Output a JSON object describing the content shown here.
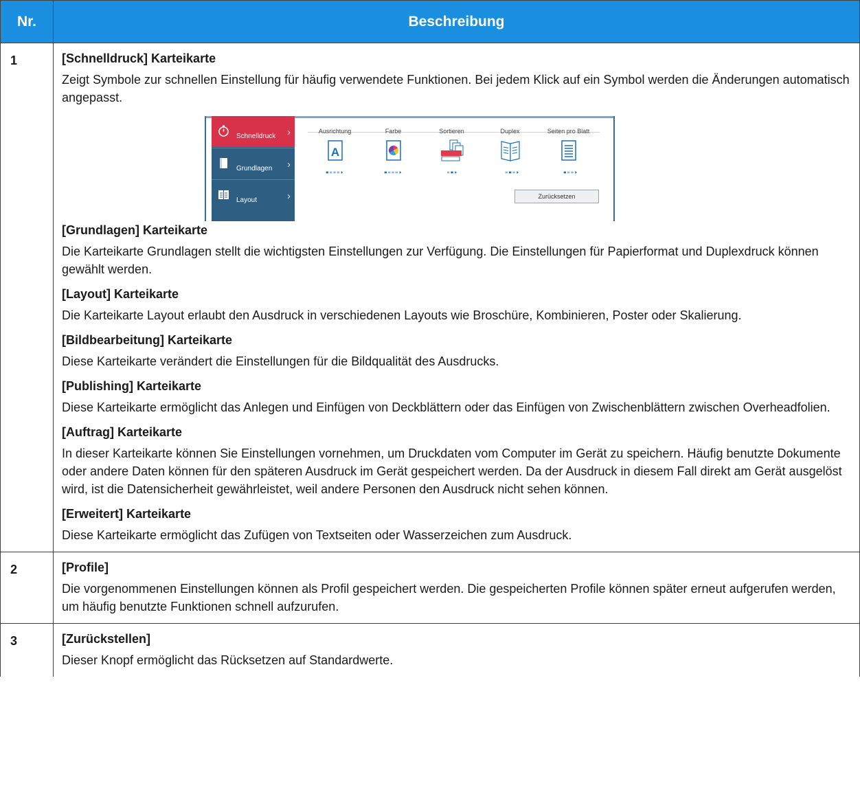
{
  "table": {
    "headers": [
      "Nr.",
      "Beschreibung"
    ],
    "rows": [
      {
        "nr": "1",
        "sections": [
          {
            "title": "[Schnelldruck] Karteikarte",
            "text": "Zeigt Symbole zur schnellen Einstellung für häufig verwendete Funktionen. Bei jedem Klick auf ein Symbol werden die Änderungen automatisch angepasst."
          },
          {
            "title": "[Grundlagen] Karteikarte",
            "text": "Die Karteikarte Grundlagen stellt die wichtigsten Einstellungen zur Verfügung. Die Einstellungen für Papierformat und Duplexdruck können gewählt werden."
          },
          {
            "title": "[Layout] Karteikarte",
            "text": "Die Karteikarte Layout erlaubt den Ausdruck in verschiedenen Layouts wie Broschüre, Kombinieren, Poster oder Skalierung."
          },
          {
            "title": "[Bildbearbeitung] Karteikarte",
            "text": "Diese Karteikarte verändert die Einstellungen für die Bildqualität des Ausdrucks."
          },
          {
            "title": "[Publishing] Karteikarte",
            "text": "Diese Karteikarte ermöglicht das Anlegen und Einfügen von Deckblättern oder das Einfügen von Zwischenblättern zwischen Overheadfolien."
          },
          {
            "title": "[Auftrag] Karteikarte",
            "text": "In dieser Karteikarte können Sie Einstellungen vornehmen, um Druckdaten vom Computer im Gerät zu speichern. Häufig benutzte Dokumente oder andere Daten können für den späteren Ausdruck im Gerät gespeichert werden. Da der Ausdruck in diesem Fall direkt am Gerät ausgelöst wird, ist die Datensicherheit gewährleistet, weil andere Personen den Ausdruck nicht sehen können."
          },
          {
            "title": "[Erweitert] Karteikarte",
            "text": "Diese Karteikarte ermöglicht das Zufügen von Textseiten oder Wasserzeichen zum Ausdruck."
          }
        ]
      },
      {
        "nr": "2",
        "sections": [
          {
            "title": "[Profile]",
            "text": "Die vorgenommenen Einstellungen können als Profil gespeichert werden. Die gespeicherten Profile können später erneut aufgerufen werden, um häufig benutzte Funktionen schnell aufzurufen."
          }
        ]
      },
      {
        "nr": "3",
        "sections": [
          {
            "title": "[Zurückstellen]",
            "text": "Dieser Knopf ermöglicht das Rücksetzen auf Standardwerte."
          }
        ]
      }
    ]
  },
  "screenshot": {
    "sidebar": [
      {
        "label": "Schnelldruck",
        "icon": "stopwatch-icon",
        "active": true
      },
      {
        "label": "Grundlagen",
        "icon": "page-icon",
        "active": false
      },
      {
        "label": "Layout",
        "icon": "layout-icon",
        "active": false
      }
    ],
    "columns": [
      "Ausrichtung",
      "Farbe",
      "Sortieren",
      "Duplex",
      "Seiten pro Blatt"
    ],
    "reset_label": "Zurücksetzen",
    "colors": {
      "sidebar": "#2e5f83",
      "active": "#d8314a",
      "accent": "#1a8fe0"
    }
  }
}
